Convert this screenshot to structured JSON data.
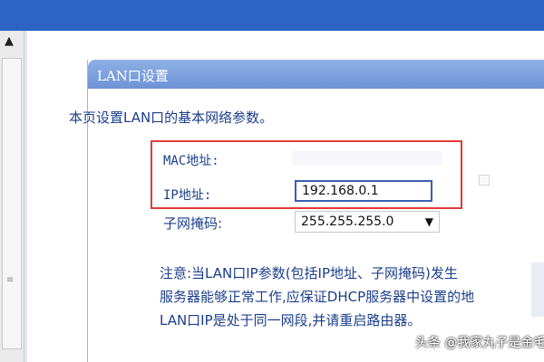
{
  "panel": {
    "title": "LAN口设置"
  },
  "description": "本页设置LAN口的基本网络参数。",
  "fields": {
    "mac_label": "MAC地址:",
    "ip_label": "IP地址:",
    "ip_value": "192.168.0.1",
    "subnet_label": "子网掩码:",
    "subnet_value": "255.255.255.0"
  },
  "note": {
    "line1": "注意:当LAN口IP参数(包括IP地址、子网掩码)发生",
    "line2": "服务器能够正常工作,应保证DHCP服务器中设置的地",
    "line3": "LAN口IP是处于同一网段,并请重启路由器。"
  },
  "watermark": "头条 @我家丸子是金毛",
  "colors": {
    "highlight_border": "#e23a3a",
    "header_blue": "#6d93d6",
    "text_blue": "#1b3f8b"
  }
}
